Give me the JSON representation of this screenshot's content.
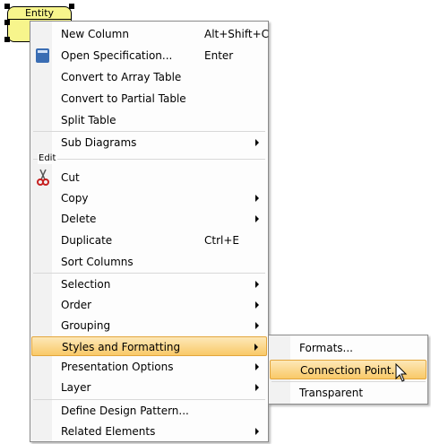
{
  "entity": {
    "title": "Entity"
  },
  "context_menu": {
    "items": [
      {
        "label": "New Column",
        "shortcut": "Alt+Shift+C"
      },
      {
        "label": "Open Specification...",
        "shortcut": "Enter",
        "icon": "specification-icon"
      },
      {
        "label": "Convert to Array Table"
      },
      {
        "label": "Convert to Partial Table"
      },
      {
        "label": "Split Table"
      },
      {
        "label": "Sub Diagrams",
        "submenu": true
      },
      {
        "label": "Cut",
        "icon": "scissors-icon"
      },
      {
        "label": "Copy",
        "submenu": true
      },
      {
        "label": "Delete",
        "submenu": true
      },
      {
        "label": "Duplicate",
        "shortcut": "Ctrl+E"
      },
      {
        "label": "Sort Columns"
      },
      {
        "label": "Selection",
        "submenu": true
      },
      {
        "label": "Order",
        "submenu": true
      },
      {
        "label": "Grouping",
        "submenu": true
      },
      {
        "label": "Styles and Formatting",
        "submenu": true,
        "highlighted": true
      },
      {
        "label": "Presentation Options",
        "submenu": true
      },
      {
        "label": "Layer",
        "submenu": true
      },
      {
        "label": "Define Design Pattern..."
      },
      {
        "label": "Related Elements",
        "submenu": true
      }
    ],
    "group_labels": {
      "edit": "Edit"
    }
  },
  "submenu": {
    "items": [
      {
        "label": "Formats..."
      },
      {
        "label": "Connection Point...",
        "highlighted": true
      },
      {
        "label": "Transparent"
      }
    ]
  },
  "colors": {
    "entity_fill": "#f7f58c",
    "highlight_top": "#fde8b8",
    "highlight_bottom": "#f9c968",
    "highlight_border": "#e3a63c"
  }
}
